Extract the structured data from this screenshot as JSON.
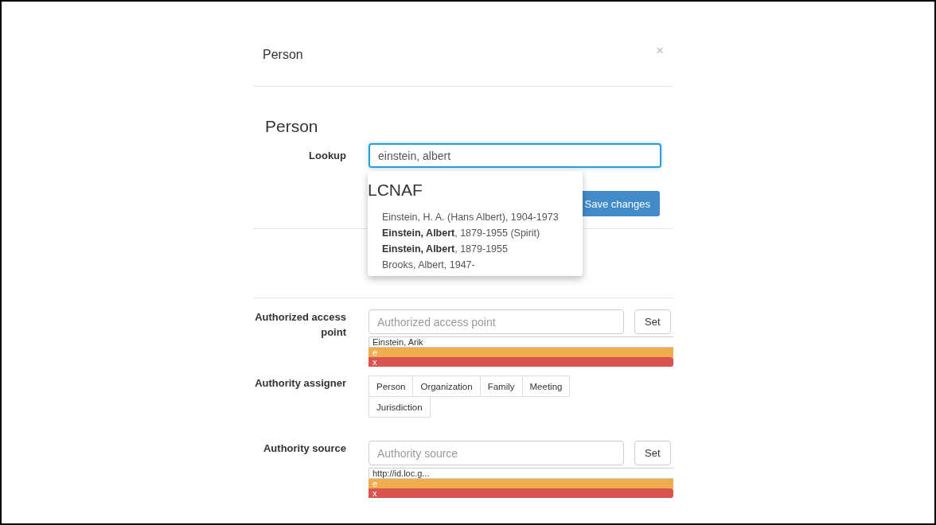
{
  "modal": {
    "title": "Person",
    "close": "×"
  },
  "form": {
    "heading": "Person",
    "lookup": {
      "label": "Lookup",
      "value": "einstein, albert"
    },
    "suggestions": {
      "title": "LCNAF",
      "items": [
        {
          "text": "Einstein, H. A. (Hans Albert), 1904-1973"
        },
        {
          "text": "**Einstein, Albert**, 1879-1955 (Spirit)"
        },
        {
          "text": "**Einstein, Albert**, 1879-1955"
        },
        {
          "text": "Brooks, Albert, 1947-"
        }
      ]
    },
    "save_button": "Save changes",
    "authorized_access_point": {
      "label": "Authorized access point",
      "placeholder": "Authorized access point",
      "button": "Set",
      "tag": {
        "text": "Einstein, Arik",
        "edit": "e",
        "remove": "x"
      }
    },
    "authority_assigner": {
      "label": "Authority assigner",
      "options": [
        {
          "label": "Person"
        },
        {
          "label": "Organization"
        },
        {
          "label": "Family"
        },
        {
          "label": "Meeting"
        },
        {
          "label": "Jurisdiction"
        }
      ]
    },
    "authority_source": {
      "label": "Authority source",
      "placeholder": "Authority source",
      "button": "Set",
      "tag": {
        "text": "http://id.loc.g...",
        "edit": "e",
        "remove": "x"
      }
    }
  }
}
